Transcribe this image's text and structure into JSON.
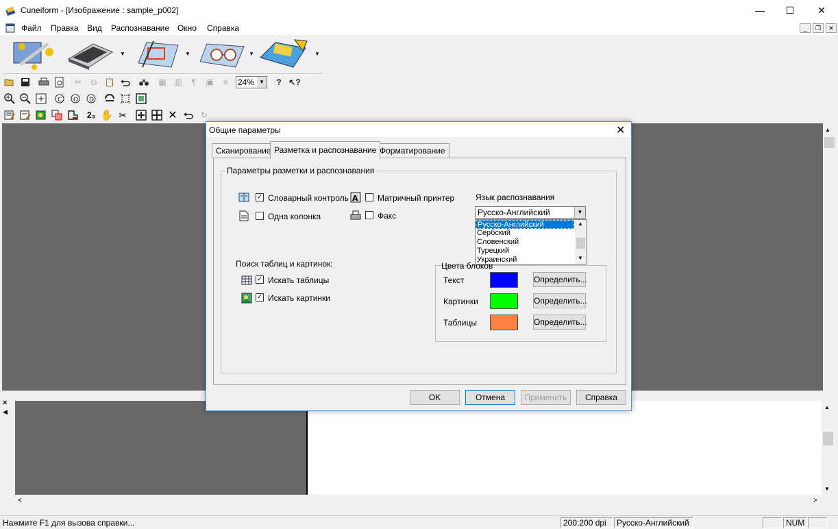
{
  "window": {
    "title": "Cuneiform - [Изображение : sample_p002]",
    "minimize": "—",
    "maximize": "☐",
    "close": "✕"
  },
  "menu": [
    "Файл",
    "Правка",
    "Вид",
    "Распознавание",
    "Окно",
    "Справка"
  ],
  "toolbar": {
    "zoom_value": "24%"
  },
  "dialog": {
    "title": "Общие параметры",
    "close": "✕",
    "tabs": [
      "Сканирование",
      "Разметка и распознавание",
      "Форматирование"
    ],
    "active_tab": 1,
    "group_title": "Параметры разметки и распознавания",
    "options": {
      "spellcheck": {
        "label": "Словарный контроль",
        "checked": true
      },
      "single_column": {
        "label": "Одна колонка",
        "checked": false
      },
      "dot_matrix": {
        "label": "Матричный принтер",
        "checked": false
      },
      "fax": {
        "label": "Факс",
        "checked": false
      }
    },
    "language_label": "Язык распознавания",
    "language_selected": "Русско-Английский",
    "language_options": [
      "Русско-Английский",
      "Сербский",
      "Словенский",
      "Турецкий",
      "Украинский"
    ],
    "search_label": "Поиск таблиц и картинок:",
    "search_tables": {
      "label": "Искать таблицы",
      "checked": true
    },
    "search_pictures": {
      "label": "Искать картинки",
      "checked": true
    },
    "colors_title": "Цвета блоков",
    "colors": [
      {
        "label": "Текст",
        "color": "#0000ff",
        "button": "Определить..."
      },
      {
        "label": "Картинки",
        "color": "#00ff00",
        "button": "Определить..."
      },
      {
        "label": "Таблицы",
        "color": "#ff8040",
        "button": "Определить..."
      }
    ],
    "buttons": {
      "ok": "OK",
      "cancel": "Отмена",
      "apply": "Применить",
      "help": "Справка"
    }
  },
  "status": {
    "hint": "Нажмите F1 для вызова справки...",
    "dpi": "200:200 dpi",
    "language": "Русско-Английский",
    "num": "NUM"
  }
}
